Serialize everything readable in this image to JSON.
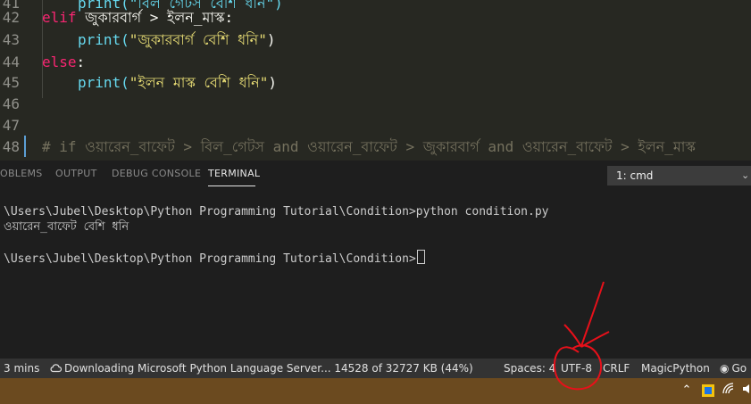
{
  "editor": {
    "lines": [
      {
        "num": "41",
        "indent": true,
        "parts": [
          {
            "t": "print(\"বিল গেটস বেশি ধনি\")",
            "c": "fn"
          }
        ]
      },
      {
        "num": "42",
        "indent": false,
        "parts": [
          {
            "t": "elif ",
            "c": "kw"
          },
          {
            "t": "জুকারবার্গ > ইলন_মাস্ক:",
            "c": ""
          }
        ]
      },
      {
        "num": "43",
        "indent": true,
        "parts": [
          {
            "t": "print(",
            "c": "fn"
          },
          {
            "t": "\"জুকারবার্গ বেশি ধনি\"",
            "c": "str"
          },
          {
            "t": ")",
            "c": ""
          }
        ]
      },
      {
        "num": "44",
        "indent": false,
        "parts": [
          {
            "t": "else",
            "c": "kw"
          },
          {
            "t": ":",
            "c": ""
          }
        ]
      },
      {
        "num": "45",
        "indent": true,
        "parts": [
          {
            "t": "print(",
            "c": "fn"
          },
          {
            "t": "\"ইলন মাস্ক বেশি ধনি\"",
            "c": "str"
          },
          {
            "t": ")",
            "c": ""
          }
        ]
      },
      {
        "num": "46",
        "indent": false,
        "parts": []
      },
      {
        "num": "47",
        "indent": false,
        "parts": []
      },
      {
        "num": "48",
        "indent": false,
        "parts": [
          {
            "t": "# if ওয়ারেন_বাফেট > বিল_গেটস and ওয়ারেন_বাফেট > জুকারবার্গ and ওয়ারেন_বাফেট > ইলন_মাস্ক",
            "c": "cm"
          }
        ]
      }
    ]
  },
  "panel": {
    "tabs": [
      {
        "label": "OBLEMS"
      },
      {
        "label": "OUTPUT"
      },
      {
        "label": "DEBUG CONSOLE"
      },
      {
        "label": "TERMINAL"
      }
    ],
    "terminal_selector": "1: cmd",
    "terminal_lines": [
      "\\Users\\Jubel\\Desktop\\Python Programming Tutorial\\Condition>python condition.py",
      "ওয়ারেন_বাফেট বেশি ধনি",
      "",
      "\\Users\\Jubel\\Desktop\\Python Programming Tutorial\\Condition>"
    ]
  },
  "statusbar": {
    "time": "3 mins",
    "download": "Downloading Microsoft Python Language Server... 14528 of 32727 KB (44%)",
    "spaces": "Spaces: 4",
    "encoding": "UTF-8",
    "eol": "CRLF",
    "language": "MagicPython",
    "live": "Go"
  },
  "colors": {
    "editor_bg": "#272822",
    "panel_bg": "#1e1e1e",
    "statusbar_bg": "#333333",
    "taskbar_bg": "#6b4a1f",
    "annotation": "#e8101a"
  }
}
